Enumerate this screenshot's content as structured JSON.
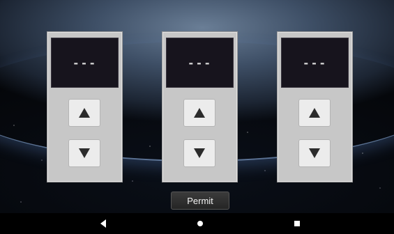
{
  "panels": [
    {
      "display_value": "---",
      "up_icon": "arrow-up-icon",
      "down_icon": "arrow-down-icon"
    },
    {
      "display_value": "---",
      "up_icon": "arrow-up-icon",
      "down_icon": "arrow-down-icon"
    },
    {
      "display_value": "---",
      "up_icon": "arrow-up-icon",
      "down_icon": "arrow-down-icon"
    }
  ],
  "permit_button": {
    "label": "Permit"
  },
  "navbar": {
    "back_icon": "back-triangle-icon",
    "home_icon": "home-circle-icon",
    "recents_icon": "recents-square-icon"
  },
  "colors": {
    "panel_bg": "#c7c7c7",
    "display_bg": "#17141d",
    "button_bg": "#ececec",
    "permit_bg": "#2f2f2f",
    "navbar_bg": "#000000"
  }
}
